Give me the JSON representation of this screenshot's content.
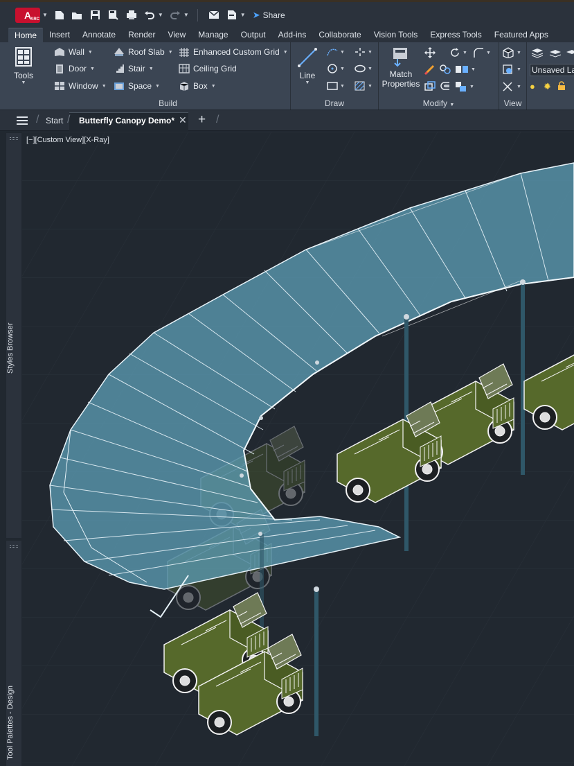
{
  "qat": {
    "app_letter": "A",
    "app_badge": "ARC",
    "share_label": "Share"
  },
  "tabs": [
    "Home",
    "Insert",
    "Annotate",
    "Render",
    "View",
    "Manage",
    "Output",
    "Add-ins",
    "Collaborate",
    "Vision Tools",
    "Express Tools",
    "Featured Apps"
  ],
  "ribbon": {
    "tools_label": "Tools",
    "build": {
      "title": "Build",
      "items": [
        "Wall",
        "Door",
        "Window",
        "Roof Slab",
        "Stair",
        "Space",
        "Enhanced Custom Grid",
        "Ceiling Grid",
        "Box"
      ]
    },
    "draw": {
      "title": "Draw",
      "line_label": "Line"
    },
    "modify": {
      "title": "Modify",
      "match_line1": "Match",
      "match_line2": "Properties"
    },
    "view": {
      "title": "View"
    },
    "layer_value": "Unsaved Lay"
  },
  "file_tabs": {
    "start": "Start",
    "active": "Butterfly Canopy Demo*"
  },
  "side_palettes": {
    "top": "Styles Browser",
    "bottom": "Tool Palettes - Design"
  },
  "viewport": {
    "label": "[−][Custom View][X-Ray]"
  },
  "colors": {
    "canopy": "#5fa3bd",
    "vehicle": "#56692b",
    "background": "#212830",
    "accent": "#c8102e"
  }
}
